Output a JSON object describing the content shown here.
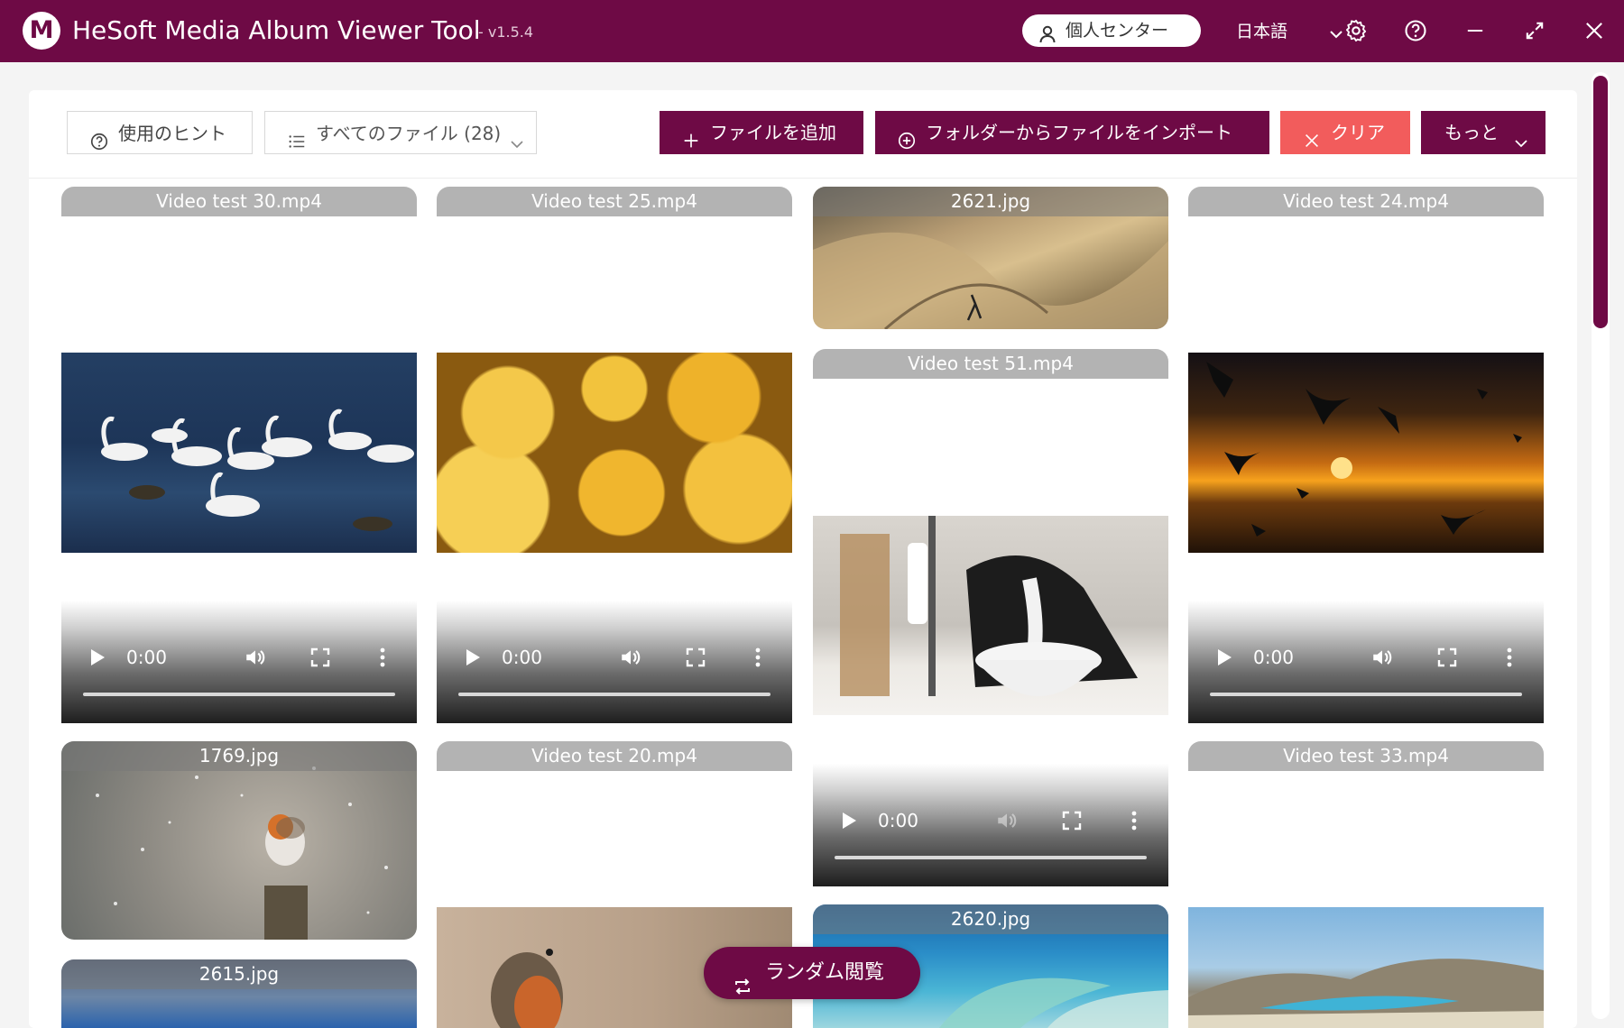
{
  "app": {
    "title": "HeSoft Media Album Viewer Tool",
    "version": "- v1.5.4",
    "logo_letter": "M",
    "profile_label": "個人センター",
    "language": "日本語",
    "accent_color": "#6e0a45",
    "danger_color": "#f25c5c"
  },
  "toolbar": {
    "hint_label": "使用のヒント",
    "filter_label": "すべてのファイル (28)",
    "add_file_label": "ファイルを追加",
    "import_folder_label": "フォルダーからファイルをインポート",
    "clear_label": "クリア",
    "more_label": "もっと"
  },
  "random_view_label": "ランダム閲覧",
  "player": {
    "time": "0:00"
  },
  "files": {
    "v30": "Video test 30.mp4",
    "v25": "Video test 25.mp4",
    "j2621": "2621.jpg",
    "v24": "Video test 24.mp4",
    "v51": "Video test 51.mp4",
    "j1769": "1769.jpg",
    "v20": "Video test 20.mp4",
    "v33": "Video test 33.mp4",
    "j2615": "2615.jpg",
    "j2620": "2620.jpg"
  }
}
